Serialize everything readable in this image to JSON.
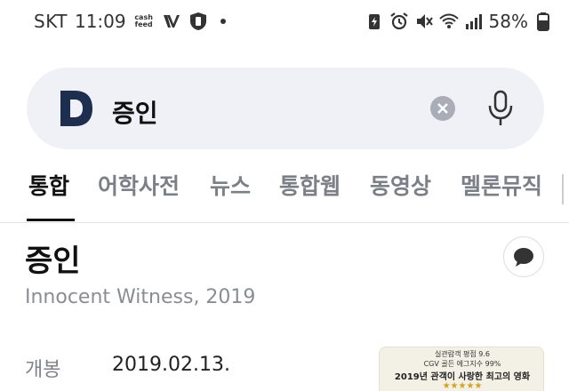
{
  "status_bar": {
    "carrier": "SKT",
    "time": "11:09",
    "cashfeed": [
      "cash",
      "feed"
    ],
    "battery": "58%",
    "icons_left": [
      "cashfeed-icon",
      "vpn-icon",
      "shield-app-icon"
    ],
    "icons_right": [
      "battery-saver-icon",
      "alarm-icon",
      "mute-icon",
      "wifi-icon",
      "signal-icon",
      "battery-icon"
    ]
  },
  "search": {
    "logo_letter": "D",
    "query": "증인",
    "colors": {
      "bar": "#eff1f6",
      "logo": "#1e2e4e"
    }
  },
  "tabs": [
    {
      "label": "통합",
      "active": true
    },
    {
      "label": "어학사전",
      "active": false
    },
    {
      "label": "뉴스",
      "active": false
    },
    {
      "label": "통합웹",
      "active": false
    },
    {
      "label": "동영상",
      "active": false
    },
    {
      "label": "멜론뮤직",
      "active": false
    }
  ],
  "result": {
    "title": "증인",
    "subtitle": "Innocent Witness, 2019",
    "info": [
      {
        "label": "개봉",
        "value": "2019.02.13."
      }
    ],
    "poster": {
      "line1": "실관람객 평점 9.6",
      "line2": "CGV 골든 에그지수 99%",
      "line3": "2019년 관객이 사랑한 최고의 영화",
      "stars": "★★★★★"
    }
  }
}
